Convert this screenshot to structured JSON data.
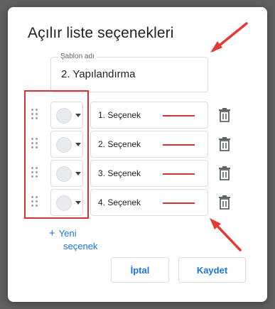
{
  "dialog": {
    "title": "Açılır liste seçenekleri",
    "template_name": {
      "label": "Şablon adı",
      "value": "2. Yapılandırma"
    },
    "options": [
      {
        "label": "1. Seçenek",
        "color_icon": "empty-color-circle"
      },
      {
        "label": "2. Seçenek",
        "color_icon": "empty-color-circle"
      },
      {
        "label": "3. Seçenek",
        "color_icon": "empty-color-circle"
      },
      {
        "label": "4. Seçenek",
        "color_icon": "empty-color-circle"
      }
    ],
    "add_option": {
      "plus": "+",
      "line1": "Yeni",
      "line2": "seçenek"
    },
    "buttons": {
      "cancel": "İptal",
      "save": "Kaydet"
    }
  },
  "colors": {
    "accent": "#1a73e8",
    "annotation_red": "#d93035",
    "overlay": "#5f5f5f"
  }
}
